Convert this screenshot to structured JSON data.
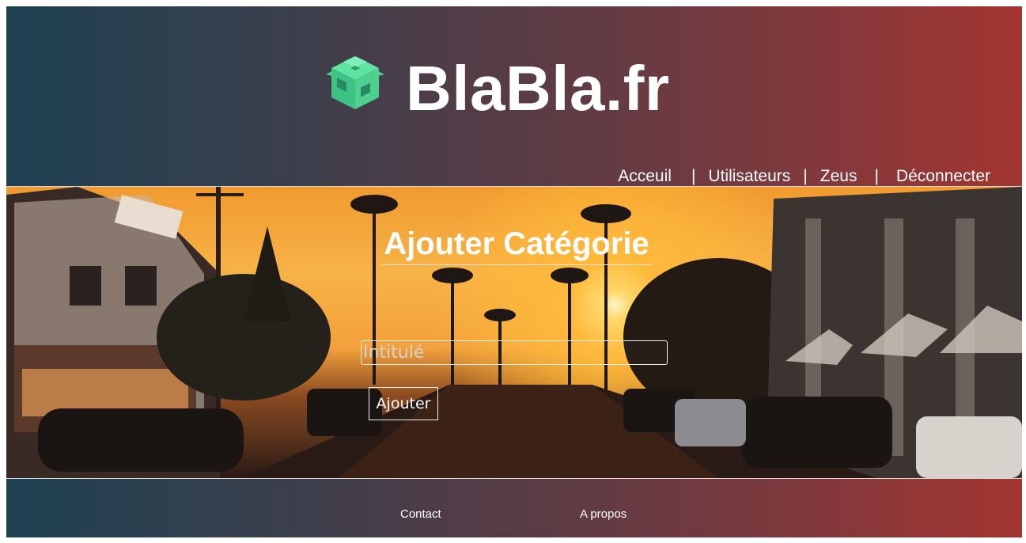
{
  "header": {
    "site_title": "BlaBla.fr",
    "logo_icon": "cube-logo-icon",
    "logo_color": "#4fd08e"
  },
  "nav": {
    "items": [
      "Acceuil",
      "Utilisateurs",
      "Zeus",
      "Déconnecter"
    ],
    "separator": "|"
  },
  "main": {
    "title": "Ajouter Catégorie",
    "input_placeholder": "Intitulé",
    "input_value": "",
    "submit_label": "Ajouter"
  },
  "footer": {
    "links": [
      "Contact",
      "A propos"
    ]
  },
  "colors": {
    "gradient_start": "#1e4152",
    "gradient_end": "#a33530"
  }
}
